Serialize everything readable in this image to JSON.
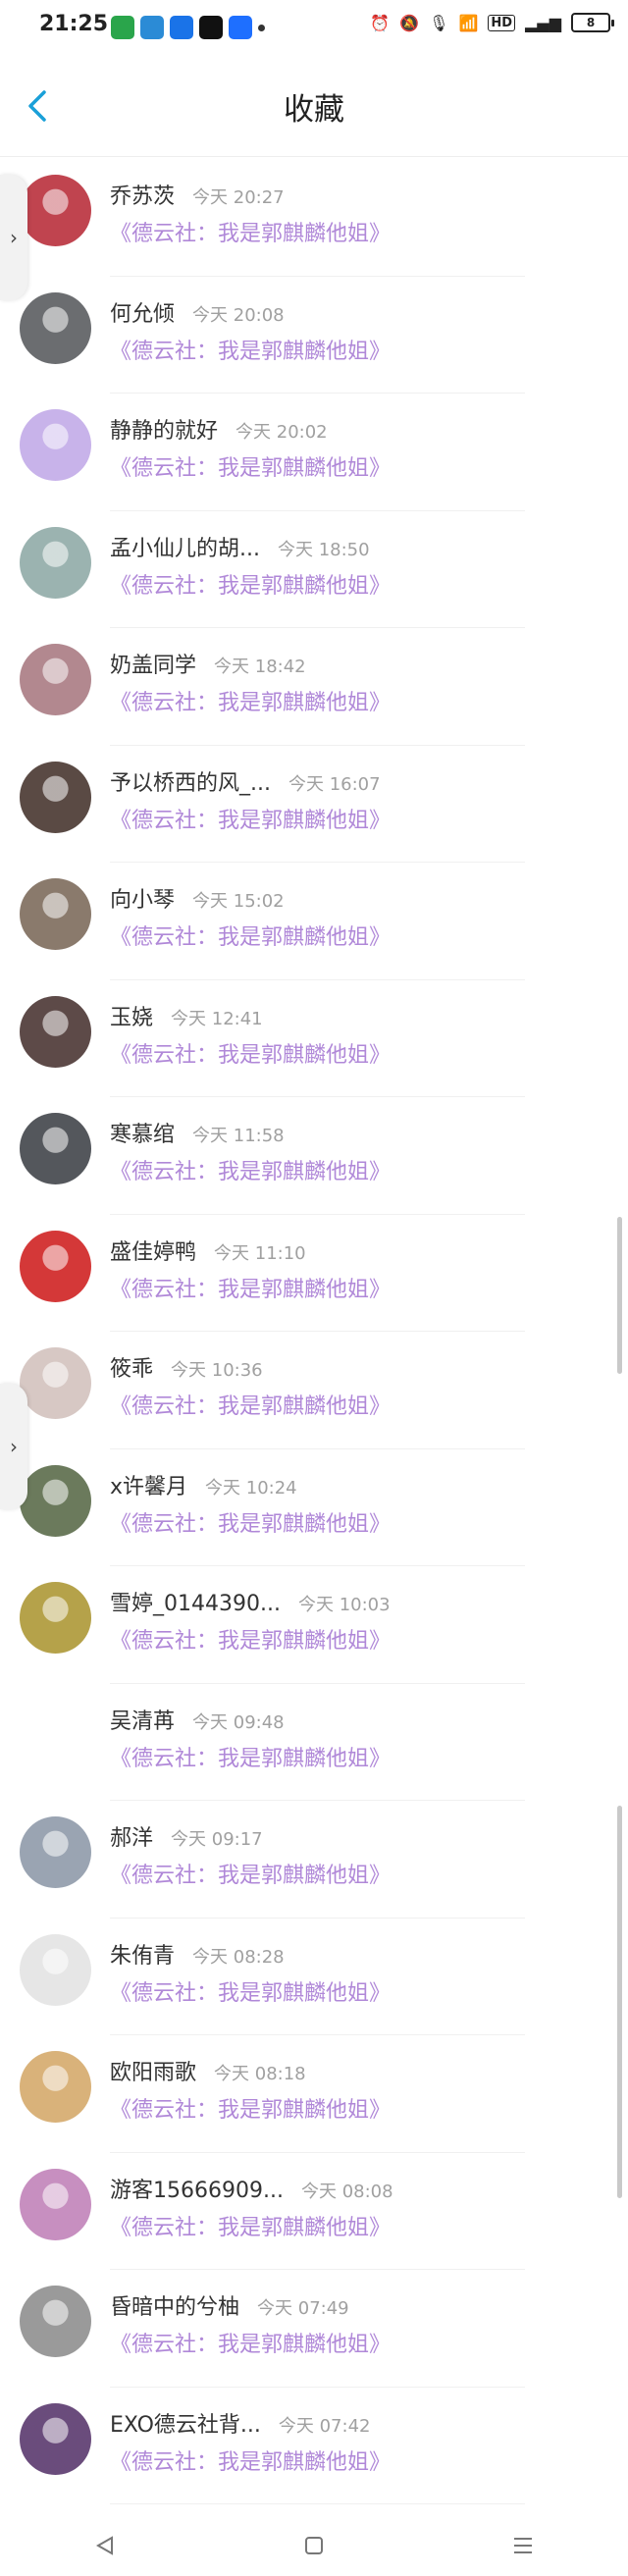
{
  "status_bar": {
    "time": "21:25",
    "network": "HD",
    "battery": "8"
  },
  "header": {
    "back_icon": "chevron-left-icon",
    "title": "收藏"
  },
  "items": [
    {
      "name": "乔苏茨",
      "time": "今天 20:27",
      "message": "《德云社：我是郭麒麟他姐》",
      "avatar_color": "#c0444f"
    },
    {
      "name": "何允倾",
      "time": "今天 20:08",
      "message": "《德云社：我是郭麒麟他姐》",
      "avatar_color": "#6b6d70"
    },
    {
      "name": "静静的就好",
      "time": "今天 20:02",
      "message": "《德云社：我是郭麒麟他姐》",
      "avatar_color": "#c8b3ea"
    },
    {
      "name": "孟小仙儿的胡...",
      "time": "今天 18:50",
      "message": "《德云社：我是郭麒麟他姐》",
      "avatar_color": "#9bb3b0"
    },
    {
      "name": "奶盖同学",
      "time": "今天 18:42",
      "message": "《德云社：我是郭麒麟他姐》",
      "avatar_color": "#b2888f"
    },
    {
      "name": "予以桥西的风_...",
      "time": "今天 16:07",
      "message": "《德云社：我是郭麒麟他姐》",
      "avatar_color": "#5a4a44"
    },
    {
      "name": "向小琴",
      "time": "今天 15:02",
      "message": "《德云社：我是郭麒麟他姐》",
      "avatar_color": "#8a7a6c"
    },
    {
      "name": "玉娆",
      "time": "今天 12:41",
      "message": "《德云社：我是郭麒麟他姐》",
      "avatar_color": "#5d4a48"
    },
    {
      "name": "寒慕绾",
      "time": "今天 11:58",
      "message": "《德云社：我是郭麒麟他姐》",
      "avatar_color": "#54575c"
    },
    {
      "name": "盛佳婷鸭",
      "time": "今天 11:10",
      "message": "《德云社：我是郭麒麟他姐》",
      "avatar_color": "#d43838"
    },
    {
      "name": "筱乖",
      "time": "今天 10:36",
      "message": "《德云社：我是郭麒麟他姐》",
      "avatar_color": "#d7c8c4"
    },
    {
      "name": "x许馨月",
      "time": "今天 10:24",
      "message": "《德云社：我是郭麒麟他姐》",
      "avatar_color": "#6b7a5c"
    },
    {
      "name": "雪婷_0144390...",
      "time": "今天 10:03",
      "message": "《德云社：我是郭麒麟他姐》",
      "avatar_color": "#b5a24a"
    },
    {
      "name": "吴清苒",
      "time": "今天 09:48",
      "message": "《德云社：我是郭麒麟他姐》",
      "avatar_color": "#ffffff"
    },
    {
      "name": "郝洋",
      "time": "今天 09:17",
      "message": "《德云社：我是郭麒麟他姐》",
      "avatar_color": "#9aa4b2"
    },
    {
      "name": "朱侑青",
      "time": "今天 08:28",
      "message": "《德云社：我是郭麒麟他姐》",
      "avatar_color": "#e6e6e6"
    },
    {
      "name": "欧阳雨歌",
      "time": "今天 08:18",
      "message": "《德云社：我是郭麒麟他姐》",
      "avatar_color": "#d9b27a"
    },
    {
      "name": "游客15666909...",
      "time": "今天 08:08",
      "message": "《德云社：我是郭麒麟他姐》",
      "avatar_color": "#c78fc0"
    },
    {
      "name": "昏暗中的兮柚",
      "time": "今天 07:49",
      "message": "《德云社：我是郭麒麟他姐》",
      "avatar_color": "#9a9a9a"
    },
    {
      "name": "EXO德云社背...",
      "time": "今天 07:42",
      "message": "《德云社：我是郭麒麟他姐》",
      "avatar_color": "#6a4c7c"
    }
  ],
  "colors": {
    "accent_back": "#1aa0d8",
    "message_purple": "#b088d8"
  }
}
